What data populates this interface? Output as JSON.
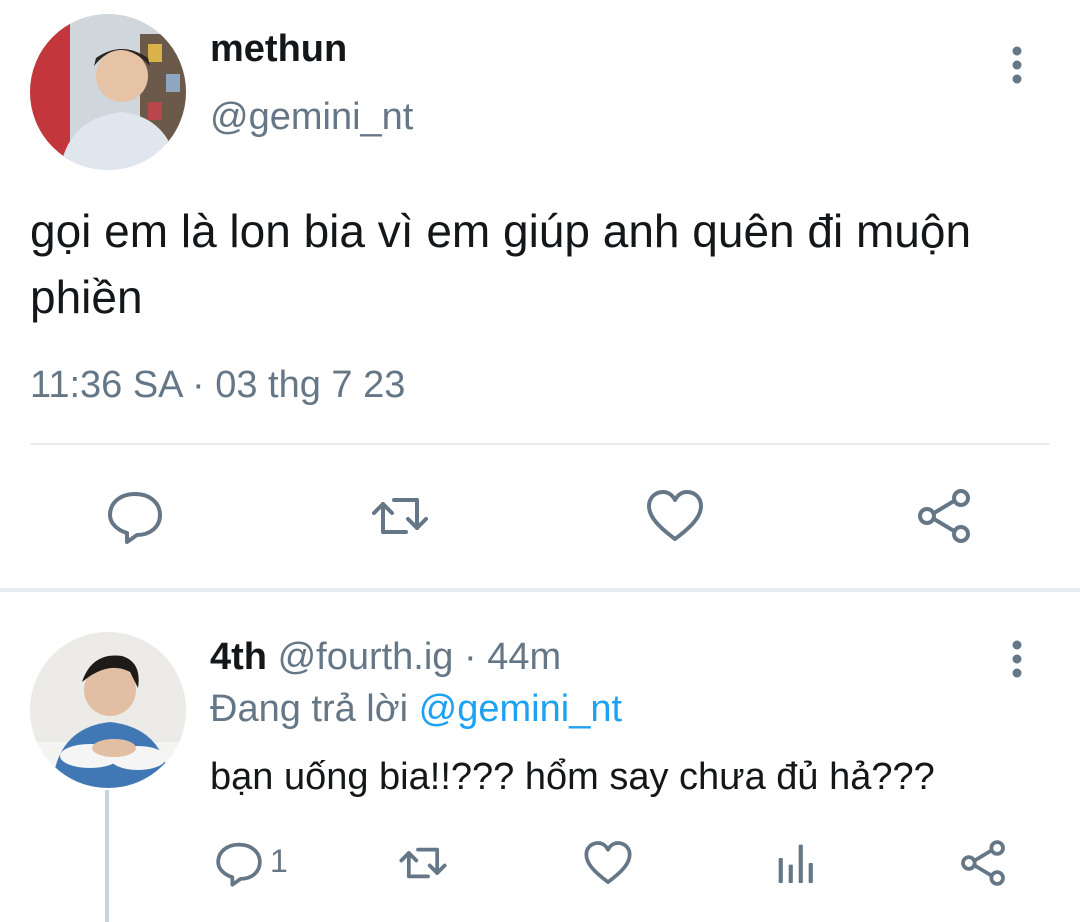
{
  "main_tweet": {
    "display_name": "methun",
    "handle": "@gemini_nt",
    "text": "gọi em là lon bia vì em giúp anh quên đi muộn phiền",
    "timestamp": "11:36 SA · 03 thg 7 23",
    "avatar_icon": "avatar-photo",
    "actions": [
      "reply-icon",
      "retweet-icon",
      "like-icon",
      "share-icon"
    ]
  },
  "reply_tweet": {
    "display_name": "4th",
    "meta": "@fourth.ig · 44m",
    "replying_prefix": "Đang trả lời",
    "replying_to": "@gemini_nt",
    "text": "bạn uống bia!!??? hổm say chưa đủ hả???",
    "reply_count": "1",
    "avatar_icon": "avatar-photo",
    "actions": [
      "reply-icon",
      "retweet-icon",
      "like-icon",
      "analytics-icon",
      "share-icon"
    ]
  },
  "colors": {
    "text_primary": "#14171a",
    "text_secondary": "#657786",
    "accent": "#1da1f2",
    "divider": "#e6ecf0",
    "icon": "#657786"
  }
}
